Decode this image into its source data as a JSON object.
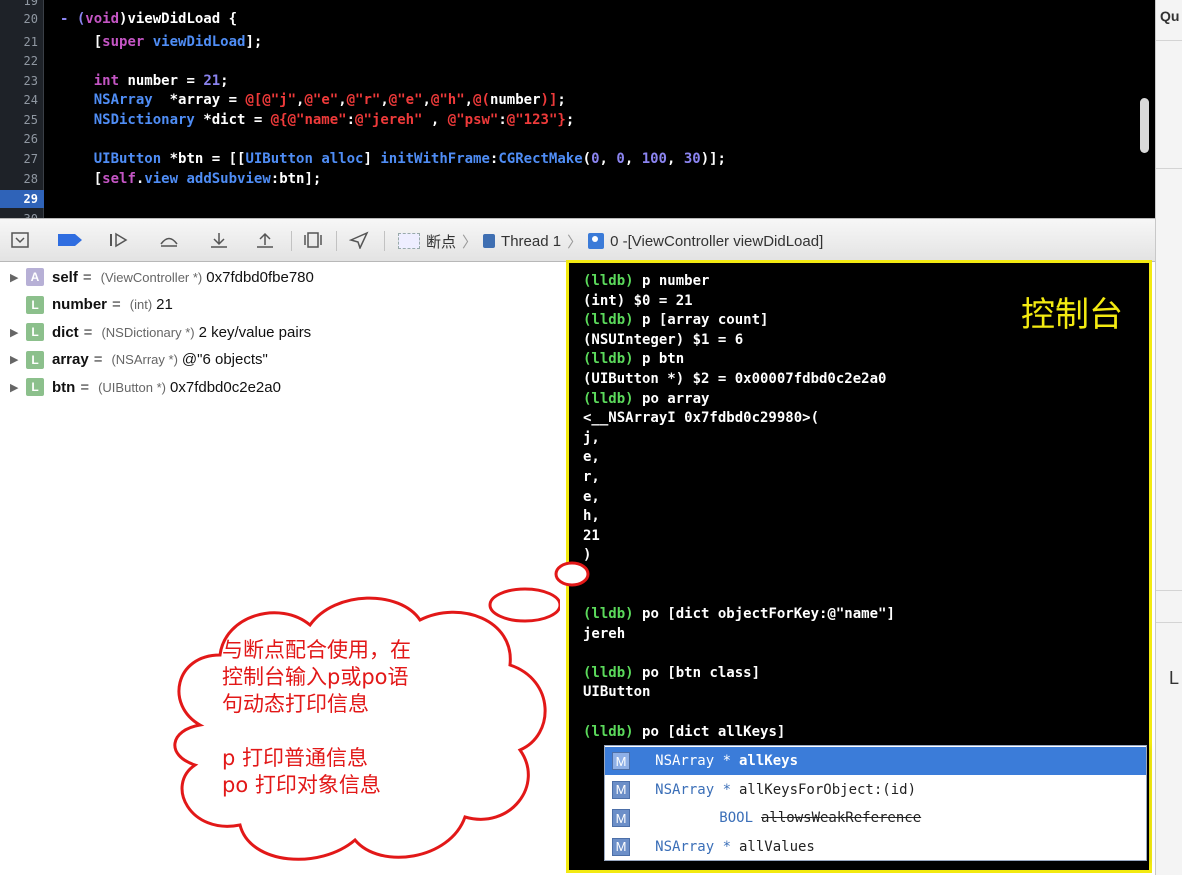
{
  "editor": {
    "line_numbers": [
      "19",
      "20",
      "21",
      "22",
      "23",
      "24",
      "25",
      "26",
      "27",
      "28",
      "29",
      "30"
    ],
    "current_line": "29"
  },
  "debug_bar": {
    "breadcrumb_breakpoint": "断点",
    "breadcrumb_thread": "Thread 1",
    "breadcrumb_frame": "0 -[ViewController viewDidLoad]"
  },
  "variables": [
    {
      "expand": true,
      "kind": "A",
      "name": "self",
      "type": "(ViewController *)",
      "value": "0x7fdbd0fbe780"
    },
    {
      "expand": false,
      "kind": "L",
      "name": "number",
      "type": "(int)",
      "value": "21"
    },
    {
      "expand": true,
      "kind": "L",
      "name": "dict",
      "type": "(NSDictionary *)",
      "value": "2 key/value pairs"
    },
    {
      "expand": true,
      "kind": "L",
      "name": "array",
      "type": "(NSArray *)",
      "value": "@\"6 objects\""
    },
    {
      "expand": true,
      "kind": "L",
      "name": "btn",
      "type": "(UIButton *)",
      "value": "0x7fdbd0c2e2a0"
    }
  ],
  "console": {
    "label": "控制台",
    "prompt": "(lldb)",
    "lines": [
      {
        "p": true,
        "t": "p number"
      },
      {
        "p": false,
        "t": "(int) $0 = 21"
      },
      {
        "p": true,
        "t": "p [array count]"
      },
      {
        "p": false,
        "t": "(NSUInteger) $1 = 6"
      },
      {
        "p": true,
        "t": "p btn"
      },
      {
        "p": false,
        "t": "(UIButton *) $2 = 0x00007fdbd0c2e2a0"
      },
      {
        "p": true,
        "t": "po array"
      },
      {
        "p": false,
        "t": "<__NSArrayI 0x7fdbd0c29980>("
      },
      {
        "p": false,
        "t": "j,"
      },
      {
        "p": false,
        "t": "e,"
      },
      {
        "p": false,
        "t": "r,"
      },
      {
        "p": false,
        "t": "e,"
      },
      {
        "p": false,
        "t": "h,"
      },
      {
        "p": false,
        "t": "21"
      },
      {
        "p": false,
        "t": ")"
      },
      {
        "p": false,
        "t": ""
      },
      {
        "p": false,
        "t": ""
      },
      {
        "p": true,
        "t": "po [dict objectForKey:@\"name\"]"
      },
      {
        "p": false,
        "t": "jereh"
      },
      {
        "p": false,
        "t": ""
      },
      {
        "p": true,
        "t": "po [btn class]"
      },
      {
        "p": false,
        "t": "UIButton"
      },
      {
        "p": false,
        "t": ""
      },
      {
        "p": true,
        "t": "po [dict allKeys]"
      }
    ]
  },
  "autocomplete": [
    {
      "kind": "M",
      "ret": "NSArray *",
      "name": "allKeys",
      "selected": true,
      "strike": false
    },
    {
      "kind": "M",
      "ret": "NSArray *",
      "name": "allKeysForObject:(id)",
      "selected": false,
      "strike": false
    },
    {
      "kind": "M",
      "ret": "BOOL",
      "name": "allowsWeakReference",
      "selected": false,
      "strike": true
    },
    {
      "kind": "M",
      "ret": "NSArray *",
      "name": "allValues",
      "selected": false,
      "strike": false
    }
  ],
  "callout": {
    "lines": [
      "与断点配合使用，在",
      "控制台输入p或po语",
      "句动态打印信息",
      "",
      "p 打印普通信息",
      "po 打印对象信息"
    ],
    "color": "#e21818"
  },
  "right_strip": {
    "top_text": "Qu",
    "mid_text": "L"
  }
}
